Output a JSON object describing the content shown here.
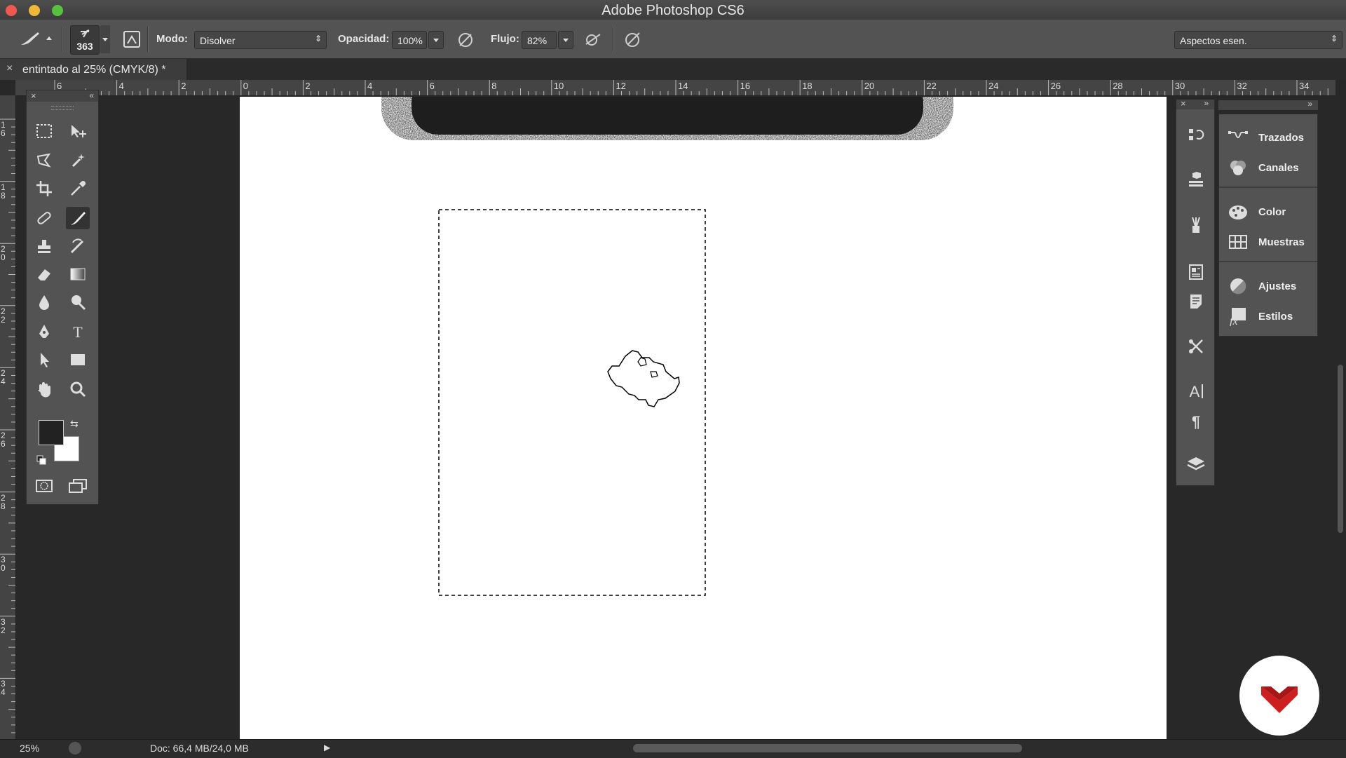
{
  "app": {
    "title": "Adobe Photoshop CS6"
  },
  "options_bar": {
    "brush_size": "363",
    "mode_label": "Modo:",
    "mode_value": "Disolver",
    "opacity_label": "Opacidad:",
    "opacity_value": "100%",
    "flow_label": "Flujo:",
    "flow_value": "82%",
    "workspace_value": "Aspectos esen."
  },
  "document": {
    "tab_title": "entintado al 25% (CMYK/8) *",
    "close_glyph": "×"
  },
  "ruler": {
    "horizontal_ticks": [
      "6",
      "4",
      "2",
      "0",
      "2",
      "4",
      "6",
      "8",
      "10",
      "12",
      "14",
      "16",
      "18",
      "20",
      "22",
      "24",
      "26",
      "28",
      "30",
      "32",
      "34"
    ],
    "vertical_ticks": [
      "1 6",
      "1 8",
      "2 0",
      "2 2",
      "2 4",
      "2 6",
      "2 8",
      "3 0",
      "3 2",
      "3 4"
    ]
  },
  "panels": {
    "items": [
      {
        "label": "Trazados",
        "icon": "paths-icon"
      },
      {
        "label": "Canales",
        "icon": "channels-icon"
      },
      {
        "label": "Color",
        "icon": "color-palette-icon"
      },
      {
        "label": "Muestras",
        "icon": "swatches-icon"
      },
      {
        "label": "Ajustes",
        "icon": "adjustments-icon"
      },
      {
        "label": "Estilos",
        "icon": "styles-icon"
      }
    ]
  },
  "status": {
    "zoom": "25%",
    "doc_info": "Doc: 66,4 MB/24,0 MB"
  },
  "colors": {
    "foreground": "#222222",
    "background": "#ffffff",
    "logo_red": "#cc1f1f"
  }
}
